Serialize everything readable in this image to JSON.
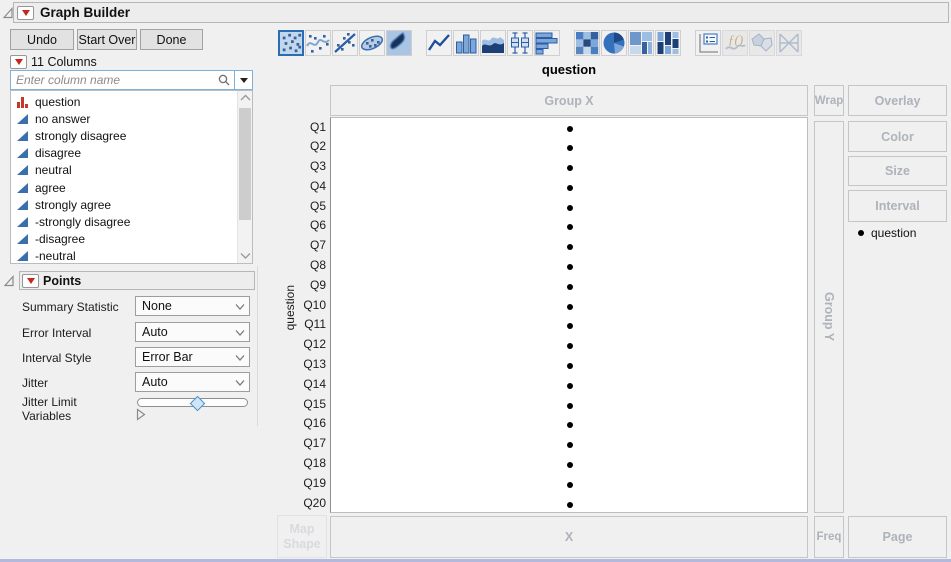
{
  "window": {
    "title": "Graph Builder"
  },
  "actions": {
    "undo": "Undo",
    "start_over": "Start Over",
    "done": "Done"
  },
  "columns_panel": {
    "header": "11 Columns",
    "search": {
      "placeholder": "Enter column name",
      "icons": [
        "search-icon",
        "dropdown-arrow-icon"
      ]
    },
    "items": [
      {
        "label": "question",
        "type": "nominal",
        "icon": "red-bars-nominal-icon"
      },
      {
        "label": "no answer",
        "type": "continuous",
        "icon": "blue-triangle-continuous-icon"
      },
      {
        "label": "strongly disagree",
        "type": "continuous",
        "icon": "blue-triangle-continuous-icon"
      },
      {
        "label": "disagree",
        "type": "continuous",
        "icon": "blue-triangle-continuous-icon"
      },
      {
        "label": "neutral",
        "type": "continuous",
        "icon": "blue-triangle-continuous-icon"
      },
      {
        "label": "agree",
        "type": "continuous",
        "icon": "blue-triangle-continuous-icon"
      },
      {
        "label": "strongly agree",
        "type": "continuous",
        "icon": "blue-triangle-continuous-icon"
      },
      {
        "label": "-strongly disagree",
        "type": "continuous",
        "icon": "blue-triangle-continuous-icon"
      },
      {
        "label": "-disagree",
        "type": "continuous",
        "icon": "blue-triangle-continuous-icon"
      },
      {
        "label": "-neutral",
        "type": "continuous",
        "icon": "blue-triangle-continuous-icon"
      }
    ]
  },
  "points_panel": {
    "header": "Points",
    "summary_statistic": {
      "label": "Summary Statistic",
      "value": "None"
    },
    "error_interval": {
      "label": "Error Interval",
      "value": "Auto"
    },
    "interval_style": {
      "label": "Interval Style",
      "value": "Error Bar"
    },
    "jitter": {
      "label": "Jitter",
      "value": "Auto"
    },
    "jitter_limit": {
      "label": "Jitter Limit",
      "value_percent": 52
    },
    "variables": {
      "label": "Variables"
    }
  },
  "graph_type_toolbar": [
    {
      "name": "points",
      "selected": true,
      "disabled": false,
      "group": 1
    },
    {
      "name": "smoother",
      "selected": false,
      "disabled": false,
      "group": 1
    },
    {
      "name": "line-of-fit",
      "selected": false,
      "disabled": false,
      "group": 1
    },
    {
      "name": "ellipse",
      "selected": false,
      "disabled": false,
      "group": 1
    },
    {
      "name": "contour",
      "selected": false,
      "disabled": false,
      "group": 1
    },
    {
      "name": "line",
      "selected": false,
      "disabled": false,
      "group": 2
    },
    {
      "name": "bar",
      "selected": false,
      "disabled": false,
      "group": 2
    },
    {
      "name": "area",
      "selected": false,
      "disabled": false,
      "group": 2
    },
    {
      "name": "box-plot",
      "selected": false,
      "disabled": false,
      "group": 2
    },
    {
      "name": "histogram",
      "selected": false,
      "disabled": false,
      "group": 2
    },
    {
      "name": "heatmap",
      "selected": false,
      "disabled": false,
      "group": 3
    },
    {
      "name": "pie",
      "selected": false,
      "disabled": false,
      "group": 3
    },
    {
      "name": "treemap",
      "selected": false,
      "disabled": false,
      "group": 3
    },
    {
      "name": "mosaic",
      "selected": false,
      "disabled": false,
      "group": 3
    },
    {
      "name": "caption-box",
      "selected": false,
      "disabled": false,
      "group": 4
    },
    {
      "name": "formula",
      "selected": false,
      "disabled": true,
      "group": 4
    },
    {
      "name": "map-shapes",
      "selected": false,
      "disabled": true,
      "group": 4
    },
    {
      "name": "parallel",
      "selected": false,
      "disabled": true,
      "group": 4
    }
  ],
  "graph": {
    "title": "question",
    "y_axis_title": "question",
    "y_categories": [
      "Q1",
      "Q2",
      "Q3",
      "Q4",
      "Q5",
      "Q6",
      "Q7",
      "Q8",
      "Q9",
      "Q10",
      "Q11",
      "Q12",
      "Q13",
      "Q14",
      "Q15",
      "Q16",
      "Q17",
      "Q18",
      "Q19",
      "Q20"
    ],
    "legend": {
      "marker": "black-dot",
      "label": "question"
    },
    "chart_data": {
      "type": "scatter",
      "title": "question",
      "y_categories": [
        "Q1",
        "Q2",
        "Q3",
        "Q4",
        "Q5",
        "Q6",
        "Q7",
        "Q8",
        "Q9",
        "Q10",
        "Q11",
        "Q12",
        "Q13",
        "Q14",
        "Q15",
        "Q16",
        "Q17",
        "Q18",
        "Q19",
        "Q20"
      ],
      "points_per_category": 1,
      "x_values": "none assigned - one dot horizontally centered per category",
      "marker_color": "#000000"
    }
  },
  "drop_zones": {
    "group_x": "Group X",
    "wrap": "Wrap",
    "overlay": "Overlay",
    "color": "Color",
    "size": "Size",
    "interval": "Interval",
    "group_y": "Group Y",
    "map_shape": "Map Shape",
    "x": "X",
    "freq": "Freq",
    "page": "Page"
  },
  "colors": {
    "accent_blue": "#2b6cb5",
    "selected_icon_bg": "#c3d7ec",
    "search_border": "#7fb2d9",
    "red_triangle": "#c3281c",
    "zone_label": "#aeb2ba",
    "continuous_icon_blue": "#3a6fae",
    "nominal_icon_red": "#c0392b",
    "panel_bg": "#f0f0f0"
  }
}
